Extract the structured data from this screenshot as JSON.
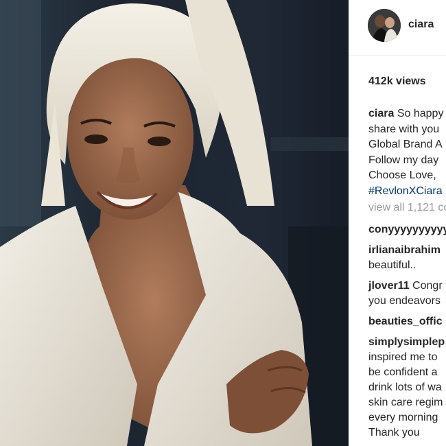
{
  "post": {
    "username": "ciara",
    "views": "412k views",
    "caption": {
      "username": "ciara",
      "lines": [
        "So happy",
        "share with you",
        "Global Brand A",
        "Follow my day",
        "Choose Love,"
      ],
      "hashtag": "#RevlonXCiara"
    },
    "view_all": "view all 1,121 co",
    "comments": [
      {
        "username": "conyyyyyyyyyy",
        "lines": []
      },
      {
        "username": "irlianaibrahim",
        "lines": [
          "beautiful.."
        ]
      },
      {
        "username": "jlover11",
        "first": "Congr",
        "lines": [
          "you endeavors"
        ]
      },
      {
        "username": "beauties_offic",
        "lines": []
      },
      {
        "username": "simplysimplep",
        "lines": [
          "inspired me to",
          "be confident a",
          "drink lots of wa",
          "skin care regim",
          "every morning",
          "Thank you"
        ]
      }
    ]
  }
}
